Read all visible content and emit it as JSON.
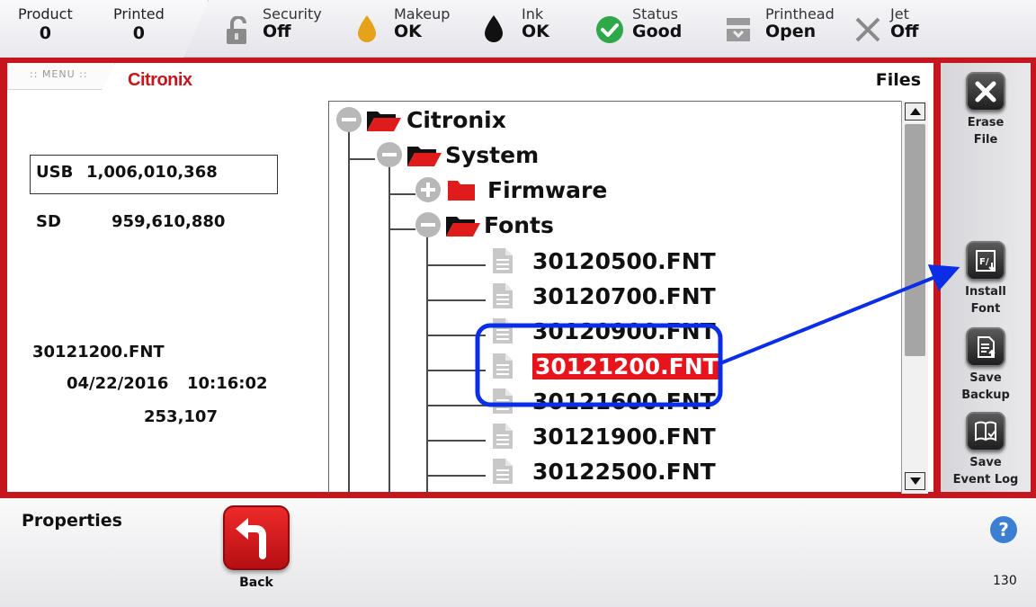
{
  "status_bar": {
    "product": {
      "label": "Product",
      "value": "0"
    },
    "printed": {
      "label": "Printed",
      "value": "0"
    },
    "security": {
      "label": "Security",
      "value": "Off",
      "icon": "padlock-open-icon"
    },
    "makeup": {
      "label": "Makeup",
      "value": "OK",
      "icon": "drop-icon",
      "color": "#e6a21a"
    },
    "ink": {
      "label": "Ink",
      "value": "OK",
      "icon": "drop-icon",
      "color": "#111111"
    },
    "status": {
      "label": "Status",
      "value": "Good",
      "icon": "check-circle-icon",
      "color": "#2fa84a"
    },
    "printhead": {
      "label": "Printhead",
      "value": "Open",
      "icon": "printhead-icon"
    },
    "jet": {
      "label": "Jet",
      "value": "Off",
      "icon": "x-icon"
    }
  },
  "header": {
    "menu_label": ":: MENU ::",
    "brand": "Citronix",
    "title": "Files"
  },
  "storage": {
    "usb": {
      "label": "USB",
      "value": "1,006,010,368"
    },
    "sd": {
      "label": "SD",
      "value": "959,610,880"
    }
  },
  "selected_file": {
    "name": "30121200.FNT",
    "date": "04/22/2016",
    "time": "10:16:02",
    "size": "253,107"
  },
  "tree": {
    "root": "Citronix",
    "system": "System",
    "firmware": "Firmware",
    "fonts": "Fonts",
    "files": [
      "30120500.FNT",
      "30120700.FNT",
      "30120900.FNT",
      "30121200.FNT",
      "30121600.FNT",
      "30121900.FNT",
      "30122500.FNT"
    ],
    "selected_index": 3
  },
  "toolbar": {
    "erase": "Erase\nFile",
    "install": "Install\nFont",
    "backup": "Save\nBackup",
    "eventlog": "Save\nEvent Log"
  },
  "bottom": {
    "properties": "Properties",
    "back": "Back",
    "help": "?",
    "screen_number": "130"
  },
  "colors": {
    "frame_red": "#c4161c",
    "selection_red": "#e8141c",
    "annotation_blue": "#0a2ee8",
    "folder_red": "#e01b1b"
  }
}
